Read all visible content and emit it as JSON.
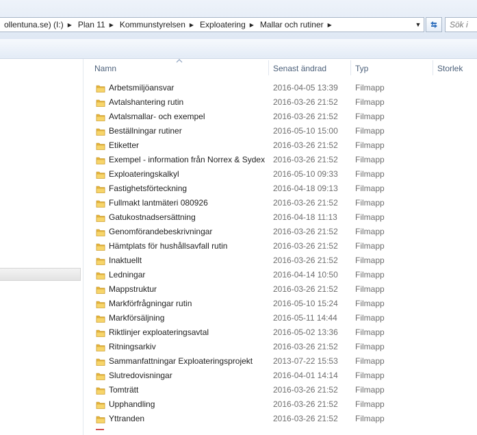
{
  "address": {
    "crumbs": [
      "ollentuna.se) (I:)",
      "Plan 11",
      "Kommunstyrelsen",
      "Exploatering",
      "Mallar och rutiner"
    ],
    "search_placeholder": "Sök i"
  },
  "columns": {
    "name": "Namn",
    "date": "Senast ändrad",
    "type": "Typ",
    "size": "Storlek"
  },
  "files": [
    {
      "name": "Arbetsmiljöansvar",
      "date": "2016-04-05 13:39",
      "type": "Filmapp"
    },
    {
      "name": "Avtalshantering rutin",
      "date": "2016-03-26 21:52",
      "type": "Filmapp"
    },
    {
      "name": "Avtalsmallar- och exempel",
      "date": "2016-03-26 21:52",
      "type": "Filmapp"
    },
    {
      "name": "Beställningar rutiner",
      "date": "2016-05-10 15:00",
      "type": "Filmapp"
    },
    {
      "name": "Etiketter",
      "date": "2016-03-26 21:52",
      "type": "Filmapp"
    },
    {
      "name": "Exempel - information från Norrex & Sydex",
      "date": "2016-03-26 21:52",
      "type": "Filmapp"
    },
    {
      "name": "Exploateringskalkyl",
      "date": "2016-05-10 09:33",
      "type": "Filmapp"
    },
    {
      "name": "Fastighetsförteckning",
      "date": "2016-04-18 09:13",
      "type": "Filmapp"
    },
    {
      "name": "Fullmakt lantmäteri 080926",
      "date": "2016-03-26 21:52",
      "type": "Filmapp"
    },
    {
      "name": "Gatukostnadsersättning",
      "date": "2016-04-18 11:13",
      "type": "Filmapp"
    },
    {
      "name": "Genomförandebeskrivningar",
      "date": "2016-03-26 21:52",
      "type": "Filmapp"
    },
    {
      "name": "Hämtplats för hushållsavfall rutin",
      "date": "2016-03-26 21:52",
      "type": "Filmapp"
    },
    {
      "name": "Inaktuellt",
      "date": "2016-03-26 21:52",
      "type": "Filmapp"
    },
    {
      "name": "Ledningar",
      "date": "2016-04-14 10:50",
      "type": "Filmapp"
    },
    {
      "name": "Mappstruktur",
      "date": "2016-03-26 21:52",
      "type": "Filmapp"
    },
    {
      "name": "Markförfrågningar rutin",
      "date": "2016-05-10 15:24",
      "type": "Filmapp"
    },
    {
      "name": "Markförsäljning",
      "date": "2016-05-11 14:44",
      "type": "Filmapp"
    },
    {
      "name": "Riktlinjer exploateringsavtal",
      "date": "2016-05-02 13:36",
      "type": "Filmapp"
    },
    {
      "name": "Ritningsarkiv",
      "date": "2016-03-26 21:52",
      "type": "Filmapp"
    },
    {
      "name": "Sammanfattningar Exploateringsprojekt",
      "date": "2013-07-22 15:53",
      "type": "Filmapp"
    },
    {
      "name": "Slutredovisningar",
      "date": "2016-04-01 14:14",
      "type": "Filmapp"
    },
    {
      "name": "Tomträtt",
      "date": "2016-03-26 21:52",
      "type": "Filmapp"
    },
    {
      "name": "Upphandling",
      "date": "2016-03-26 21:52",
      "type": "Filmapp"
    },
    {
      "name": "Yttranden",
      "date": "2016-03-26 21:52",
      "type": "Filmapp"
    }
  ]
}
